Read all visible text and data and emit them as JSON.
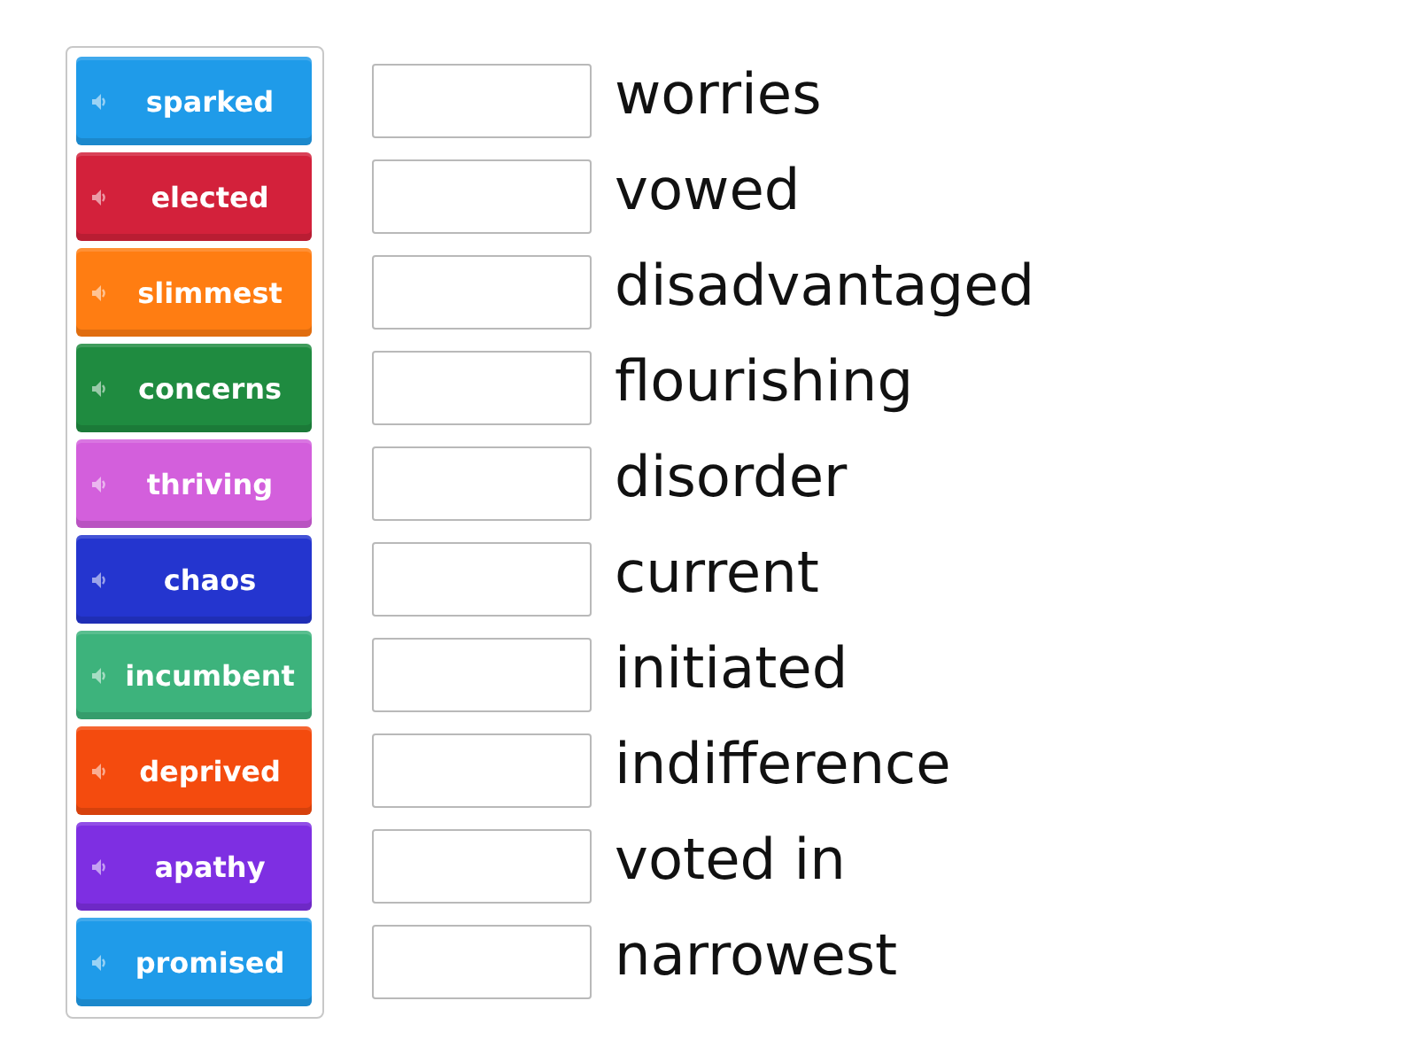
{
  "tiles": [
    {
      "label": "sparked",
      "color": "#1f9be9"
    },
    {
      "label": "elected",
      "color": "#d3213b"
    },
    {
      "label": "slimmest",
      "color": "#ff7d12"
    },
    {
      "label": "concerns",
      "color": "#1f8b40"
    },
    {
      "label": "thriving",
      "color": "#d35fdc"
    },
    {
      "label": "chaos",
      "color": "#2435cf"
    },
    {
      "label": "incumbent",
      "color": "#3db37c"
    },
    {
      "label": "deprived",
      "color": "#f44b0e"
    },
    {
      "label": "apathy",
      "color": "#7e2fe2"
    },
    {
      "label": "promised",
      "color": "#1f9be9"
    }
  ],
  "definitions": [
    "worries",
    "vowed",
    "disadvantaged",
    "flourishing",
    "disorder",
    "current",
    "initiated",
    "indifference",
    "voted in",
    "narrowest"
  ]
}
